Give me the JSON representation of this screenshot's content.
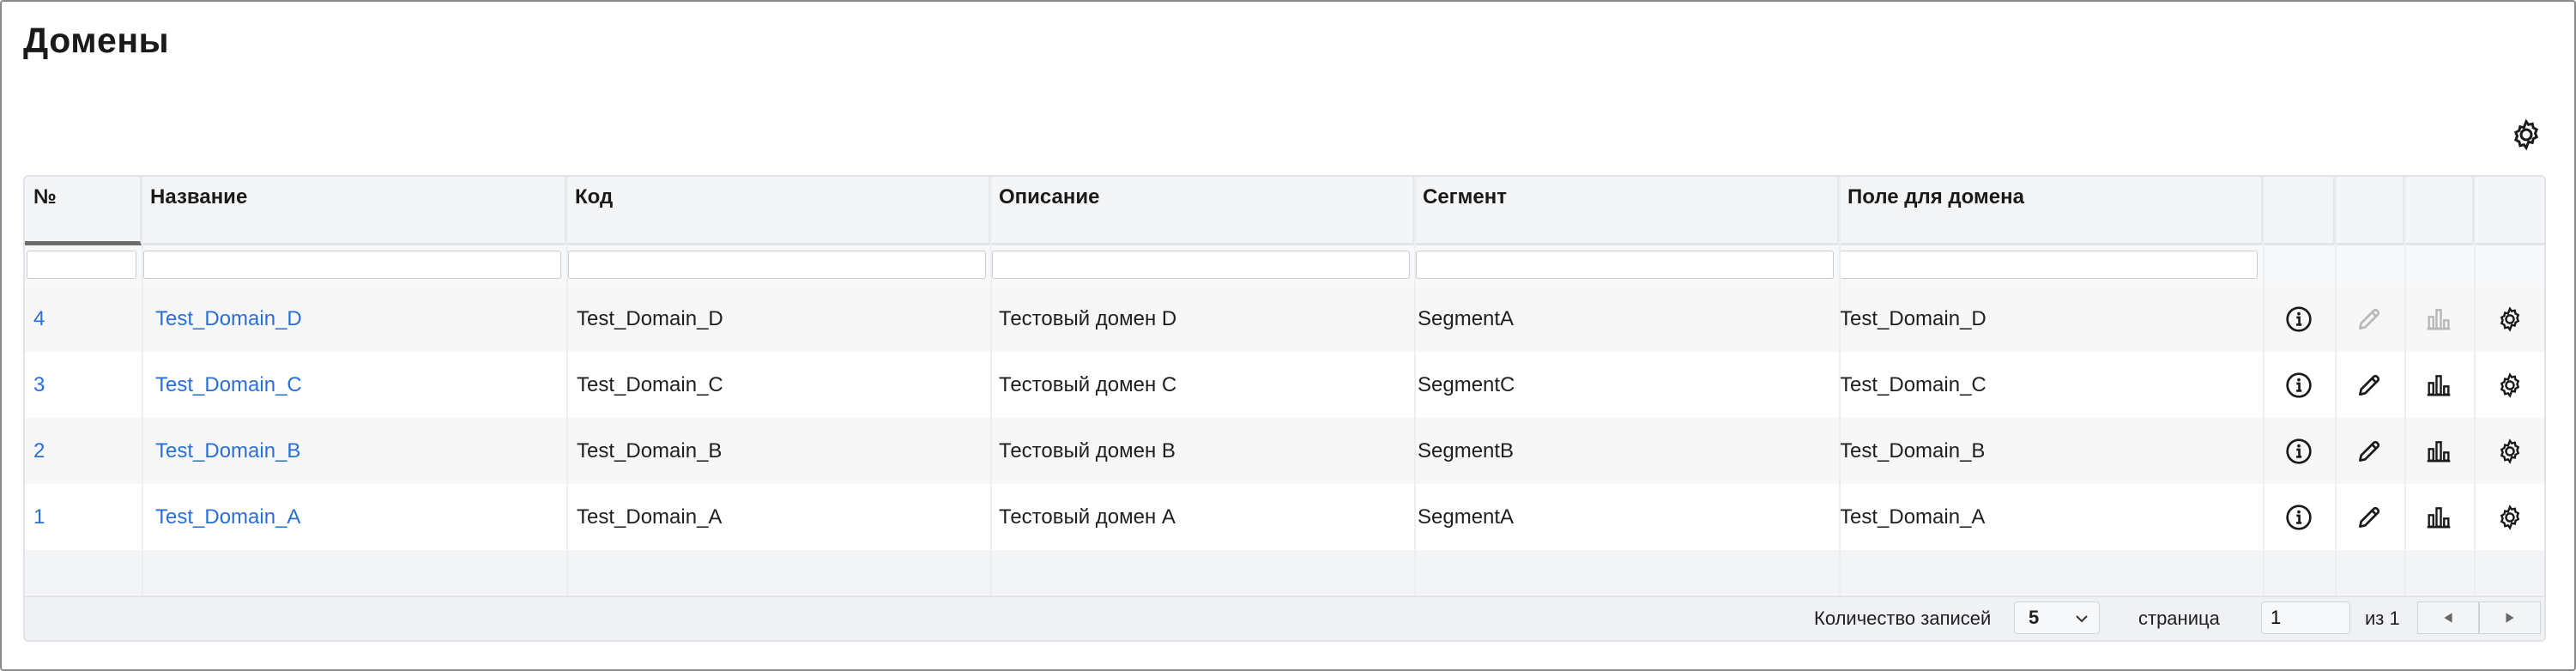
{
  "page": {
    "title": "Домены"
  },
  "columns": [
    "№",
    "Название",
    "Код",
    "Описание",
    "Сегмент",
    "Поле для домена"
  ],
  "filters": [
    "",
    "",
    "",
    "",
    "",
    ""
  ],
  "rows": [
    {
      "num": "4",
      "name": "Test_Domain_D",
      "code": "Test_Domain_D",
      "description": "Тестовый домен D",
      "segment": "SegmentA",
      "field": "Test_Domain_D",
      "edit_disabled": true,
      "stats_disabled": true
    },
    {
      "num": "3",
      "name": "Test_Domain_C",
      "code": "Test_Domain_C",
      "description": "Тестовый домен C",
      "segment": "SegmentC",
      "field": "Test_Domain_C",
      "edit_disabled": false,
      "stats_disabled": false
    },
    {
      "num": "2",
      "name": "Test_Domain_B",
      "code": "Test_Domain_B",
      "description": "Тестовый домен B",
      "segment": "SegmentB",
      "field": "Test_Domain_B",
      "edit_disabled": false,
      "stats_disabled": false
    },
    {
      "num": "1",
      "name": "Test_Domain_A",
      "code": "Test_Domain_A",
      "description": "Тестовый домен A",
      "segment": "SegmentA",
      "field": "Test_Domain_A",
      "edit_disabled": false,
      "stats_disabled": false
    }
  ],
  "footer": {
    "records_label": "Количество записей",
    "page_size": "5",
    "page_label": "страница",
    "page_value": "1",
    "of_label": "из 1",
    "prev_icon": "triangle-left",
    "next_icon": "triangle-right"
  },
  "icons": {
    "settings": "gear-icon",
    "info": "info-circle-icon",
    "edit": "pencil-icon",
    "stats": "bar-chart-icon",
    "row_settings": "gear-icon"
  },
  "colors": {
    "link": "#2a6fd6",
    "disabled_icon": "#b8b8b8"
  }
}
